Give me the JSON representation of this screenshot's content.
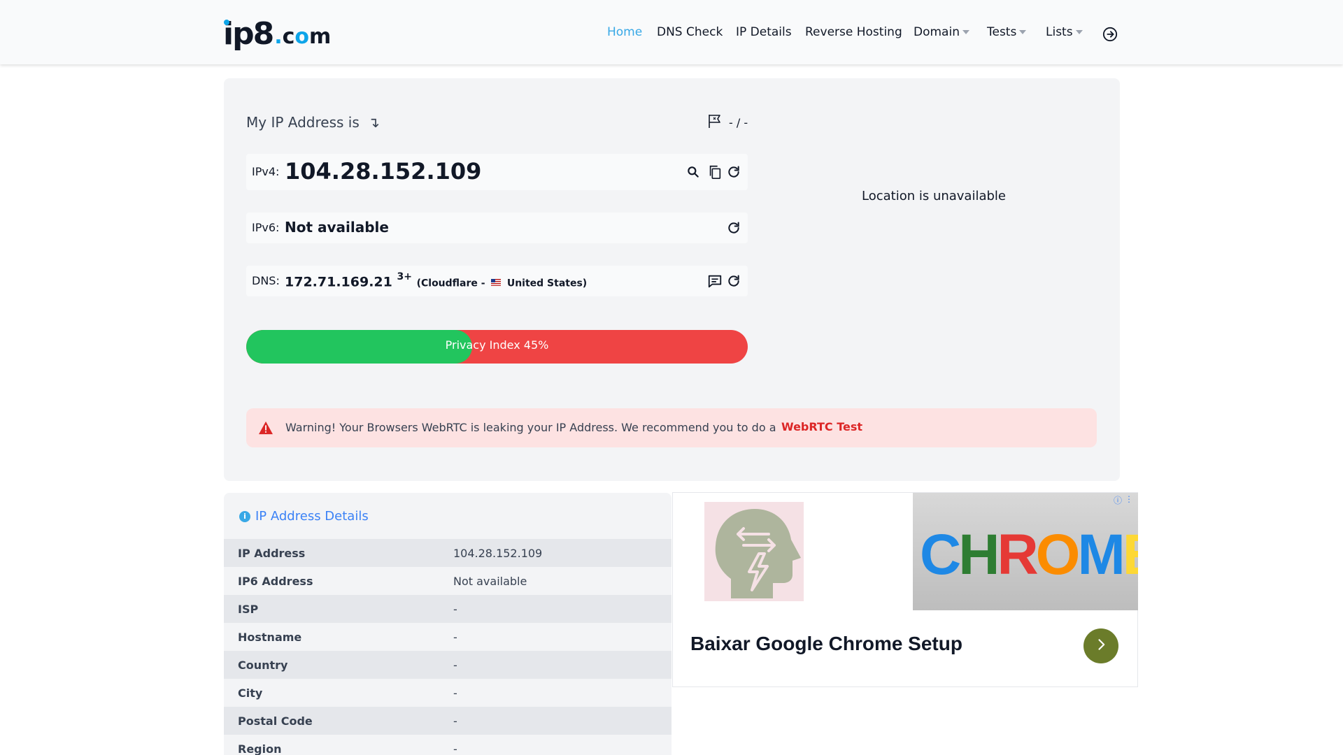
{
  "logo": {
    "ip": "ip8",
    "dot": ".",
    "c": "c",
    "o": "o",
    "m": "m"
  },
  "nav": {
    "home": "Home",
    "dns_check": "DNS Check",
    "ip_details": "IP Details",
    "reverse_hosting": "Reverse Hosting",
    "domain": "Domain",
    "tests": "Tests",
    "lists": "Lists"
  },
  "main": {
    "my_ip_label": "My IP Address is",
    "my_ip_arrow": "↴",
    "flag_text": "- / -",
    "ipv4_label": "IPv4:",
    "ipv4_value": "104.28.152.109",
    "ipv6_label": "IPv6:",
    "ipv6_value": "Not available",
    "dns_label": "DNS:",
    "dns_value": "172.71.169.21",
    "dns_count": "3+",
    "dns_provider": "(Cloudflare -",
    "dns_country": "United States)",
    "privacy_text": "Privacy Index 45%",
    "privacy_percent": 45,
    "location_text": "Location is unavailable"
  },
  "warning": {
    "text": "Warning! Your Browsers WebRTC is leaking your IP Address. We recommend you to do a",
    "link": "WebRTC Test"
  },
  "details": {
    "title": "IP Address Details",
    "rows": [
      {
        "key": "IP Address",
        "value": "104.28.152.109"
      },
      {
        "key": "IP6 Address",
        "value": "Not available"
      },
      {
        "key": "ISP",
        "value": "-"
      },
      {
        "key": "Hostname",
        "value": "-"
      },
      {
        "key": "Country",
        "value": "-"
      },
      {
        "key": "City",
        "value": "-"
      },
      {
        "key": "Postal Code",
        "value": "-"
      },
      {
        "key": "Region",
        "value": "-"
      }
    ]
  },
  "ad": {
    "title": "Baixar Google Chrome Setup",
    "image_word": "CHROME"
  },
  "colors": {
    "accent": "#38a8e6",
    "green": "#22c55e",
    "red": "#ef4444",
    "warning_bg": "#fde2e2",
    "warning_link": "#dc2626"
  },
  "icons": [
    "logout-icon",
    "flag-icon",
    "search-icon",
    "copy-icon",
    "refresh-icon",
    "message-icon",
    "warning-icon",
    "info-icon",
    "chevron-right-icon",
    "ad-choices-icon"
  ]
}
